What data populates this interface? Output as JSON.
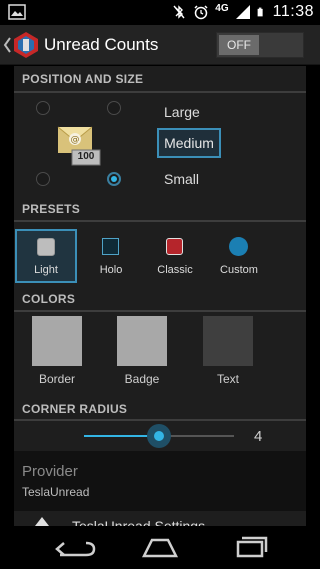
{
  "status": {
    "network": "4G",
    "time": "11:38"
  },
  "header": {
    "title": "Unread Counts",
    "toggle_label": "OFF"
  },
  "position_size": {
    "header": "POSITION AND SIZE",
    "badge_count": "100",
    "options": [
      "Large",
      "Medium",
      "Small"
    ],
    "selected": "Medium"
  },
  "presets": {
    "header": "PRESETS",
    "items": [
      {
        "label": "Light",
        "selected": true
      },
      {
        "label": "Holo",
        "selected": false
      },
      {
        "label": "Classic",
        "selected": false
      },
      {
        "label": "Custom",
        "selected": false
      }
    ]
  },
  "colors": {
    "header": "COLORS",
    "items": [
      {
        "label": "Border",
        "color": "#a8a8a8"
      },
      {
        "label": "Badge",
        "color": "#a8a8a8"
      },
      {
        "label": "Text",
        "color": "#3f3f3f"
      }
    ]
  },
  "corner_radius": {
    "header": "CORNER RADIUS",
    "value": "4"
  },
  "provider": {
    "title": "Provider",
    "value": "TeslaUnread"
  },
  "tesla_settings": {
    "label": "TeslaUnread Settings"
  },
  "accent_color": "#33b5e5"
}
